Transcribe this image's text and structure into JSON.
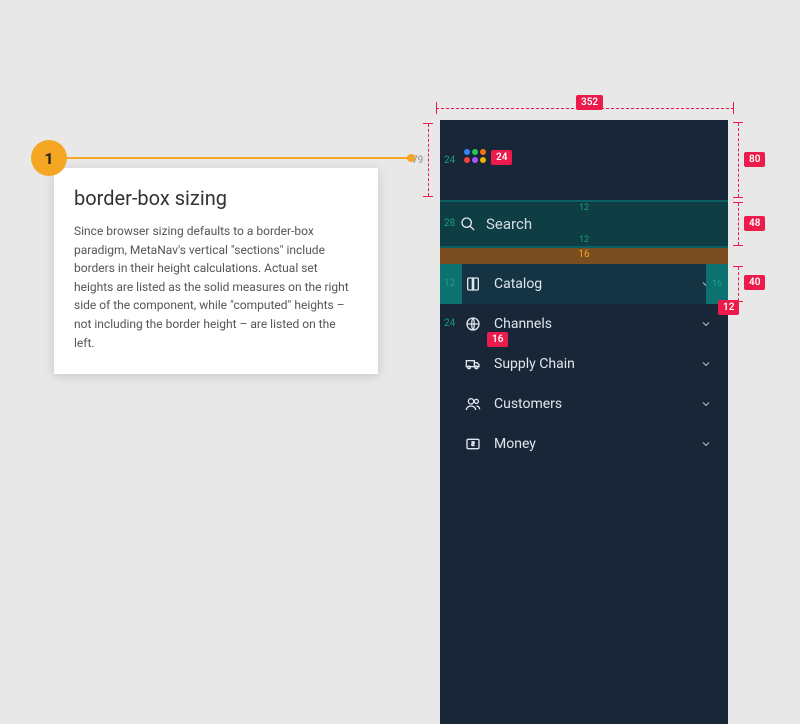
{
  "callout": {
    "badge": "1",
    "title": "border-box sizing",
    "body": "Since browser sizing defaults to a border-box paradigm, MetaNav's vertical \"sections\" include borders in their height calculations. Actual set heights are listed as the solid measures on the right side of the component, while \"computed\" heights – not including the border height – are listed on the left."
  },
  "dimensions": {
    "width": "352",
    "brand_computed": "79",
    "brand_actual": "80",
    "search_actual": "48",
    "row_actual": "40",
    "pad_brand_left": "24",
    "brand_icon": "24",
    "search_pad_v": "12",
    "divider": "16",
    "item_pad_left": "24",
    "item_icon_gap": "16",
    "item_pad_right": "16",
    "chevron": "12",
    "search_left_pad": "28",
    "row_left_pad": "12"
  },
  "search": {
    "label": "Search"
  },
  "nav": {
    "items": [
      {
        "label": "Catalog"
      },
      {
        "label": "Channels"
      },
      {
        "label": "Supply Chain"
      },
      {
        "label": "Customers"
      },
      {
        "label": "Money"
      }
    ]
  },
  "logo_colors": [
    "#3b82f6",
    "#22c55e",
    "#f97316",
    "#ef4444",
    "#a855f7",
    "#eab308",
    "#ffffff",
    "#ffffff",
    "#ffffff"
  ]
}
